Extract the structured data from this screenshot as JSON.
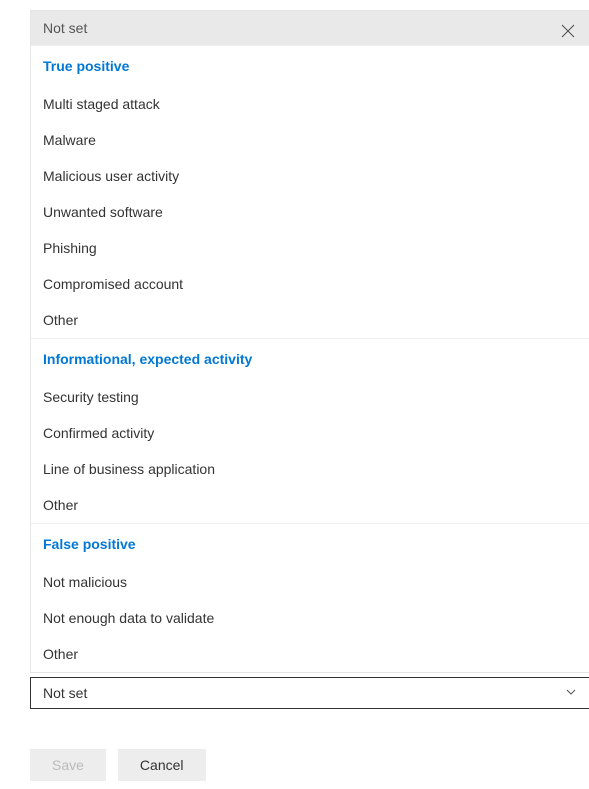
{
  "panel": {
    "header": "Not set",
    "sections": [
      {
        "title": "True positive",
        "items": [
          "Multi staged attack",
          "Malware",
          "Malicious user activity",
          "Unwanted software",
          "Phishing",
          "Compromised account",
          "Other"
        ]
      },
      {
        "title": "Informational, expected activity",
        "items": [
          "Security testing",
          "Confirmed activity",
          "Line of business application",
          "Other"
        ]
      },
      {
        "title": "False positive",
        "items": [
          "Not malicious",
          "Not enough data to validate",
          "Other"
        ]
      }
    ]
  },
  "dropdown": {
    "selected": "Not set"
  },
  "buttons": {
    "save": "Save",
    "cancel": "Cancel"
  }
}
